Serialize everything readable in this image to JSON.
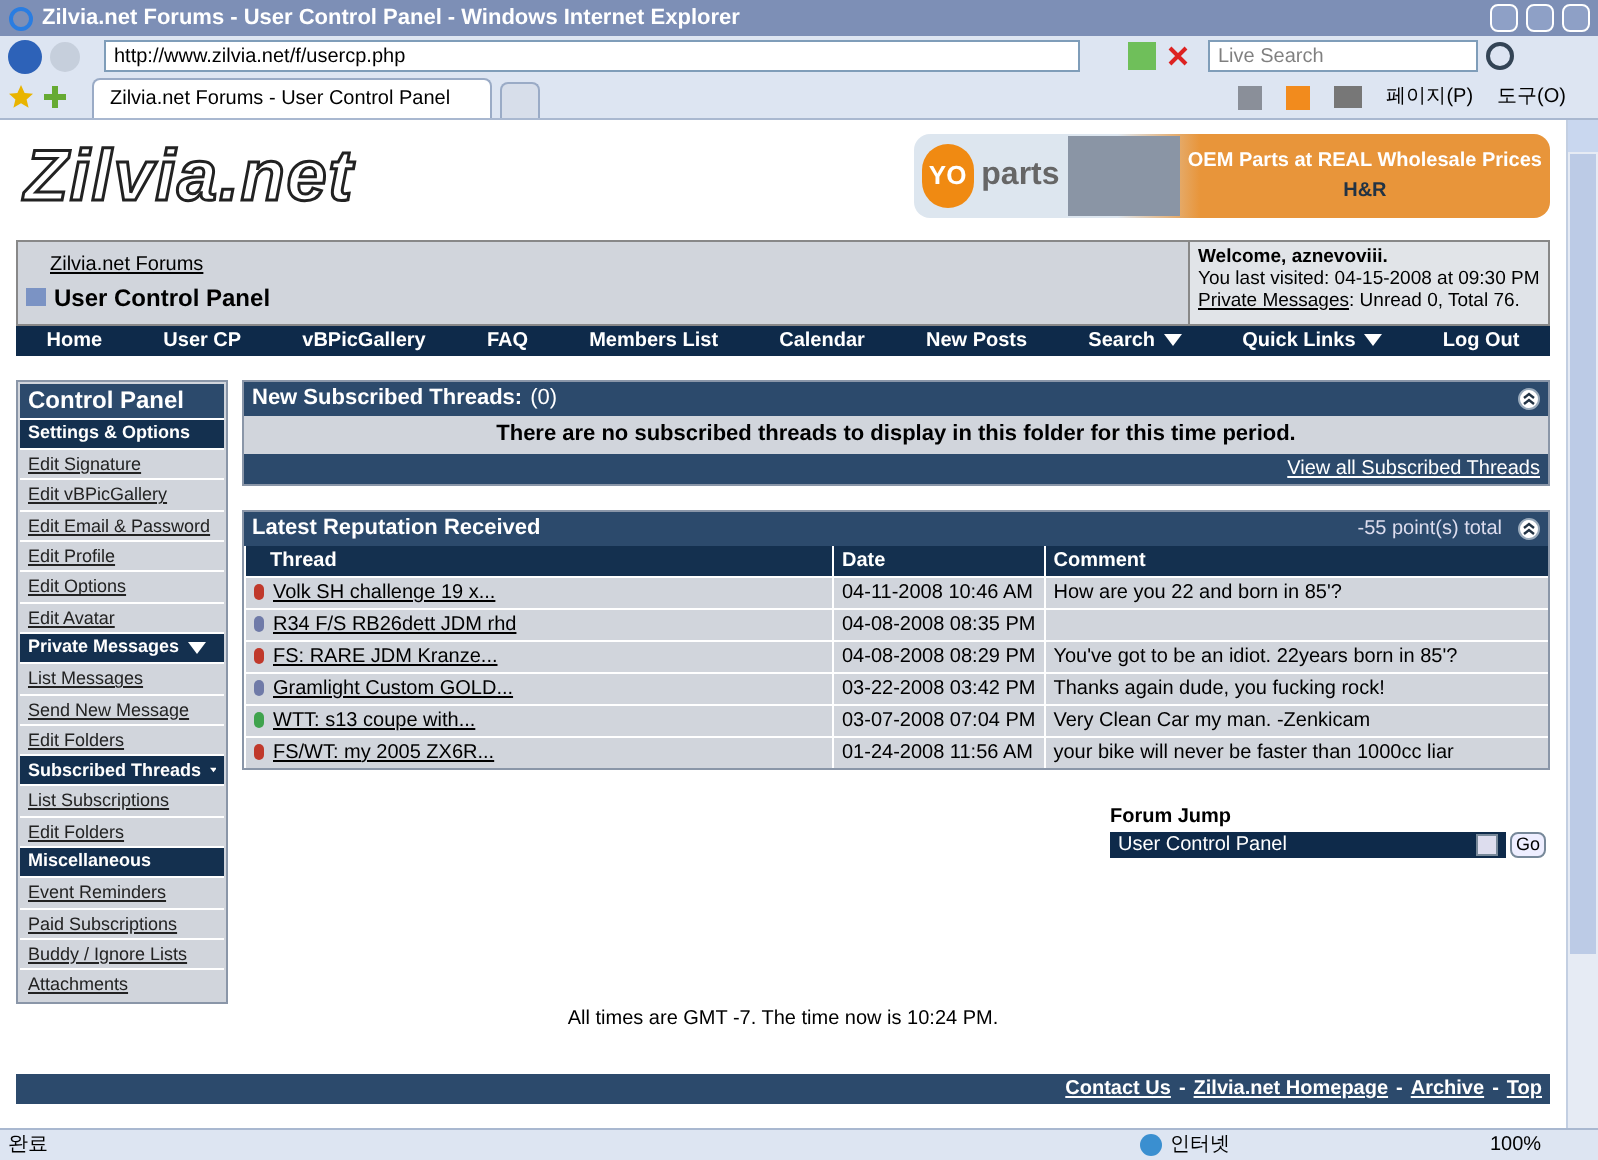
{
  "window": {
    "title": "Zilvia.net Forums - User Control Panel - Windows Internet Explorer"
  },
  "address_bar": {
    "url": "http://www.zilvia.net/f/usercp.php",
    "search_placeholder": "Live Search"
  },
  "tabs": [
    {
      "label": "Zilvia.net Forums - User Control Panel",
      "selected": true
    }
  ],
  "command_bar": {
    "page_menu": "페이지(P)",
    "tools_menu": "도구(O)"
  },
  "header": {
    "logo": "Zilvia.net",
    "banner": {
      "badge": "YO",
      "word": "parts",
      "headline": "OEM Parts at REAL Wholesale Prices",
      "brand": "H&R"
    }
  },
  "breadcrumb": {
    "parent": "Zilvia.net Forums",
    "current": "User Control Panel"
  },
  "welcome": {
    "greeting": "Welcome, aznevoviii.",
    "last_visited": "You last visited: 04-15-2008 at 09:30 PM",
    "pm_link": "Private Messages",
    "pm_counts": ": Unread 0, Total 76."
  },
  "navbar": [
    {
      "label": "Home",
      "dropdown": false
    },
    {
      "label": "User CP",
      "dropdown": false
    },
    {
      "label": "vBPicGallery",
      "dropdown": false
    },
    {
      "label": "FAQ",
      "dropdown": false
    },
    {
      "label": "Members List",
      "dropdown": false
    },
    {
      "label": "Calendar",
      "dropdown": false
    },
    {
      "label": "New Posts",
      "dropdown": false
    },
    {
      "label": "Search",
      "dropdown": true
    },
    {
      "label": "Quick Links",
      "dropdown": true
    },
    {
      "label": "Log Out",
      "dropdown": false
    }
  ],
  "sidebar": {
    "title": "Control Panel",
    "sections": [
      {
        "title": "Settings & Options",
        "collapsible": false,
        "items": [
          "Edit Signature",
          "Edit vBPicGallery",
          "Edit Email & Password",
          "Edit Profile",
          "Edit Options",
          "Edit Avatar"
        ]
      },
      {
        "title": "Private Messages",
        "collapsible": true,
        "items": [
          "List Messages",
          "Send New Message",
          "Edit Folders"
        ]
      },
      {
        "title": "Subscribed Threads",
        "collapsible": true,
        "items": [
          "List Subscriptions",
          "Edit Folders"
        ]
      },
      {
        "title": "Miscellaneous",
        "collapsible": false,
        "items": [
          "Event Reminders",
          "Paid Subscriptions",
          "Buddy / Ignore Lists",
          "Attachments"
        ]
      }
    ]
  },
  "subscribed": {
    "title": "New Subscribed Threads:",
    "count": "(0)",
    "message": "There are no subscribed threads to display in this folder for this time period.",
    "link": "View all Subscribed Threads"
  },
  "reputation": {
    "title": "Latest Reputation Received",
    "total": "-55 point(s) total",
    "columns": [
      "Thread",
      "Date",
      "Comment"
    ],
    "rows": [
      {
        "color": "#c0392b",
        "thread": "Volk SH challenge 19 x...",
        "date": "04-11-2008 10:46 AM",
        "comment": "How are you 22 and born in 85'?"
      },
      {
        "color": "#6f7aa8",
        "thread": "R34 F/S RB26dett JDM rhd",
        "date": "04-08-2008 08:35 PM",
        "comment": ""
      },
      {
        "color": "#c0392b",
        "thread": "FS: RARE JDM Kranze...",
        "date": "04-08-2008 08:29 PM",
        "comment": "You've got to be an idiot. 22years born in 85'?"
      },
      {
        "color": "#6f7aa8",
        "thread": "Gramlight Custom GOLD...",
        "date": "03-22-2008 03:42 PM",
        "comment": "Thanks again dude, you fucking rock!"
      },
      {
        "color": "#3fa34d",
        "thread": "WTT: s13 coupe with...",
        "date": "03-07-2008 07:04 PM",
        "comment": "Very Clean Car my man. -Zenkicam"
      },
      {
        "color": "#c0392b",
        "thread": "FS/WT: my 2005 ZX6R...",
        "date": "01-24-2008 11:56 AM",
        "comment": "your bike will never be faster than 1000cc liar"
      }
    ]
  },
  "forum_jump": {
    "label": "Forum Jump",
    "value": "User Control Panel",
    "button": "Go"
  },
  "time_note": "All times are GMT -7. The time now is 10:24 PM.",
  "footer_links": [
    "Contact Us",
    "Zilvia.net Homepage",
    "Archive",
    "Top"
  ],
  "footer_separator": "-",
  "status_bar": {
    "status": "완료",
    "zone": "인터넷",
    "zoom": "100%"
  }
}
